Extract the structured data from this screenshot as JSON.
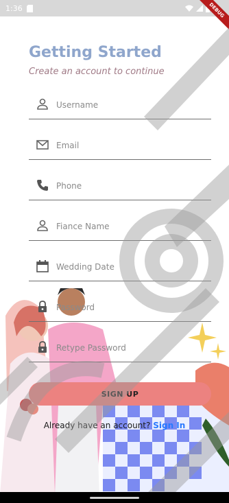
{
  "status_bar": {
    "time": "1:36",
    "debug_label": "DEBUG"
  },
  "header": {
    "title": "Getting Started",
    "subtitle": "Create an account to continue"
  },
  "form": {
    "fields": [
      {
        "placeholder": "Username",
        "icon": "person-icon"
      },
      {
        "placeholder": "Email",
        "icon": "mail-icon"
      },
      {
        "placeholder": "Phone",
        "icon": "phone-icon"
      },
      {
        "placeholder": "Fiance Name",
        "icon": "person-icon"
      },
      {
        "placeholder": "Wedding Date",
        "icon": "calendar-icon"
      },
      {
        "placeholder": "Password",
        "icon": "lock-icon"
      },
      {
        "placeholder": "Retype Password",
        "icon": "lock-icon"
      }
    ],
    "signup_label": "SIGN UP",
    "signin_prompt": "Already have an account?",
    "signin_link": "Sign In"
  },
  "colors": {
    "title": "#8fa6cc",
    "subtitle": "#a07a86",
    "button": "#ec8280",
    "link": "#2979ff"
  }
}
